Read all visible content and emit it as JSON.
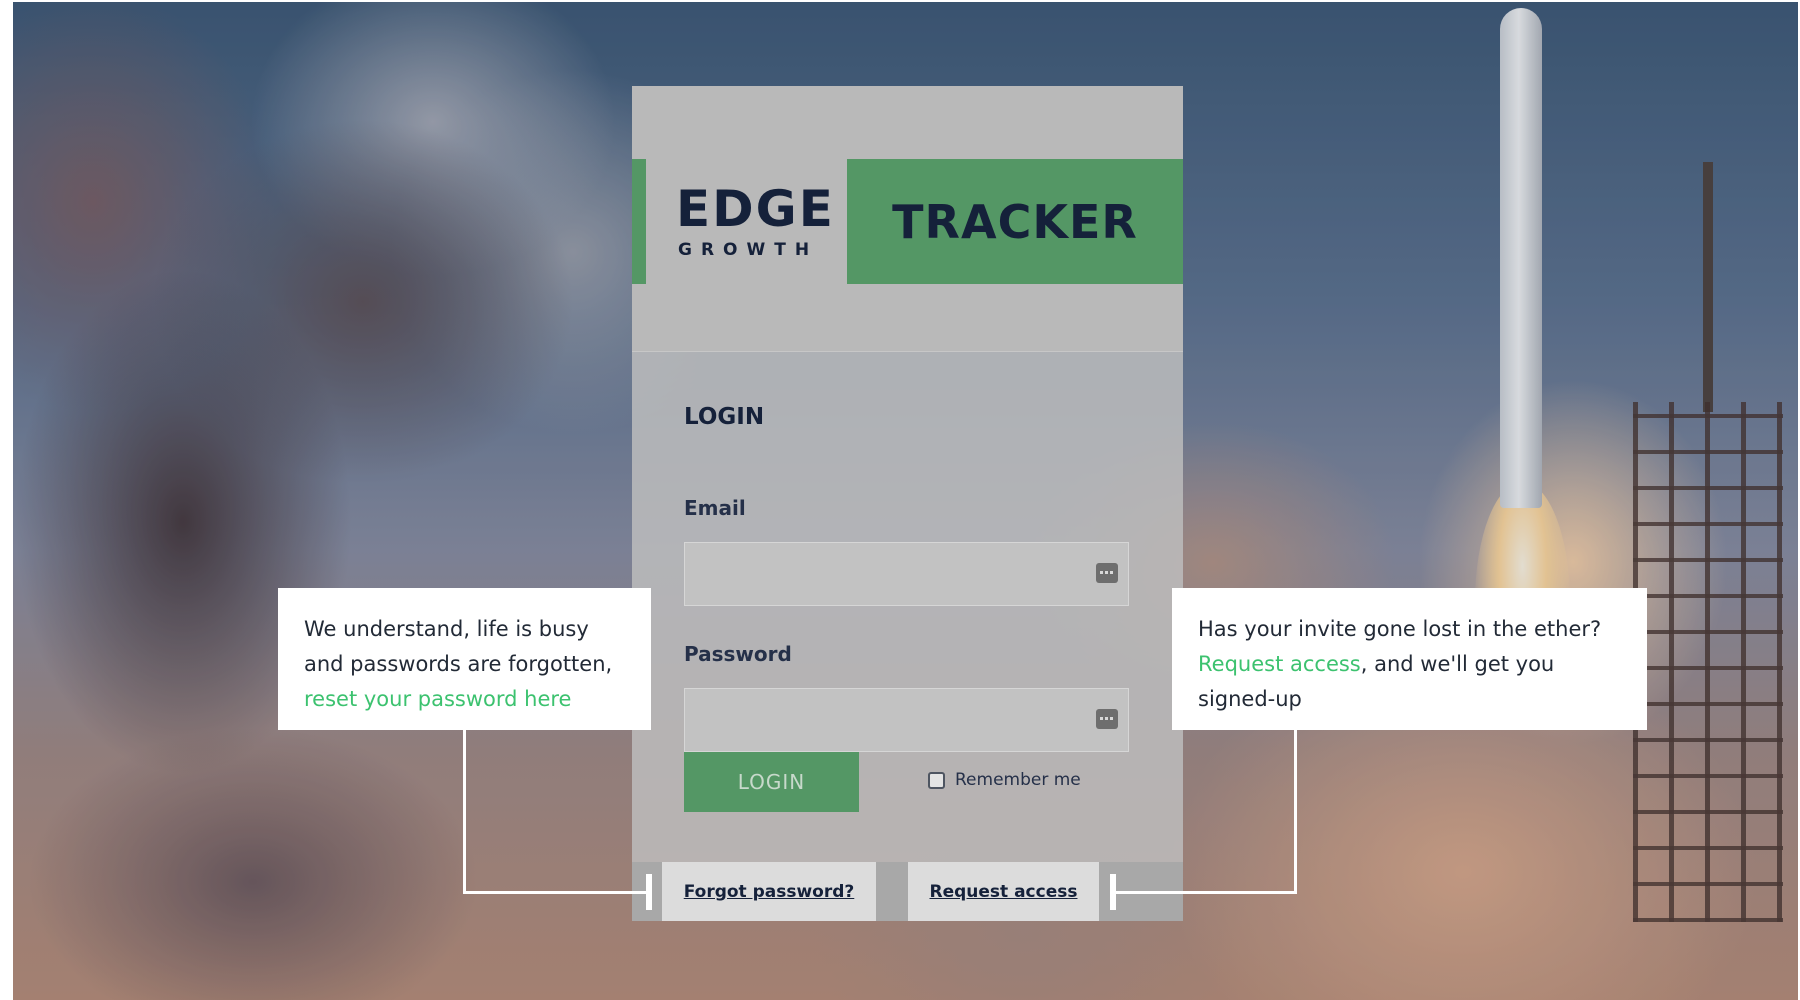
{
  "brand": {
    "logo_word": "EDGE",
    "logo_sub": "GROWTH",
    "product": "TRACKER",
    "accent_color": "#549765",
    "link_accent_color": "#3cc26f"
  },
  "login": {
    "title": "LOGIN",
    "email_label": "Email",
    "email_value": "",
    "password_label": "Password",
    "password_value": "",
    "submit_label": "LOGIN",
    "remember_label": "Remember me",
    "remember_checked": false
  },
  "footer": {
    "forgot_label": "Forgot password?",
    "request_label": "Request access"
  },
  "callouts": {
    "left": {
      "text": "We understand, life is busy and passwords are forgotten, ",
      "link": "reset your password here"
    },
    "right": {
      "text_before": "Has your invite gone lost in the ether? ",
      "link": "Request access",
      "text_after": ", and we'll get you signed-up"
    }
  },
  "icons": {
    "email_field_icon": "password-manager-key-icon",
    "password_field_icon": "password-manager-key-icon",
    "remember_checkbox": "checkbox-unchecked-icon"
  }
}
